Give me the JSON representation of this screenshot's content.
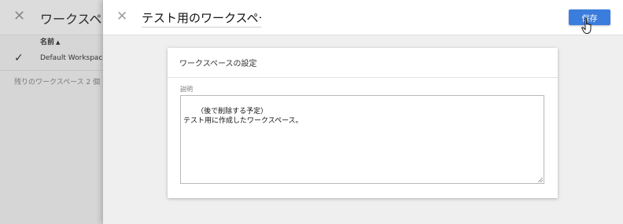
{
  "background": {
    "title": "ワークスペース",
    "column_header": "名前",
    "workspace_row": "Default Workspace",
    "remaining_text": "残りのワークスペース 2 個"
  },
  "drawer": {
    "workspace_name": "テスト用のワークスペース",
    "save_label": "保存",
    "card_title": "ワークスペースの設定",
    "description_label": "説明",
    "description_value": "（後で削除する予定）\nテスト用に作成したワークスペース。"
  },
  "icons": {
    "bg_close": "close-icon",
    "sort": "arrow-up-icon",
    "check": "check-icon",
    "drawer_close": "close-icon",
    "cursor": "hand-pointer-icon"
  },
  "colors": {
    "accent": "#3b7ddd"
  }
}
